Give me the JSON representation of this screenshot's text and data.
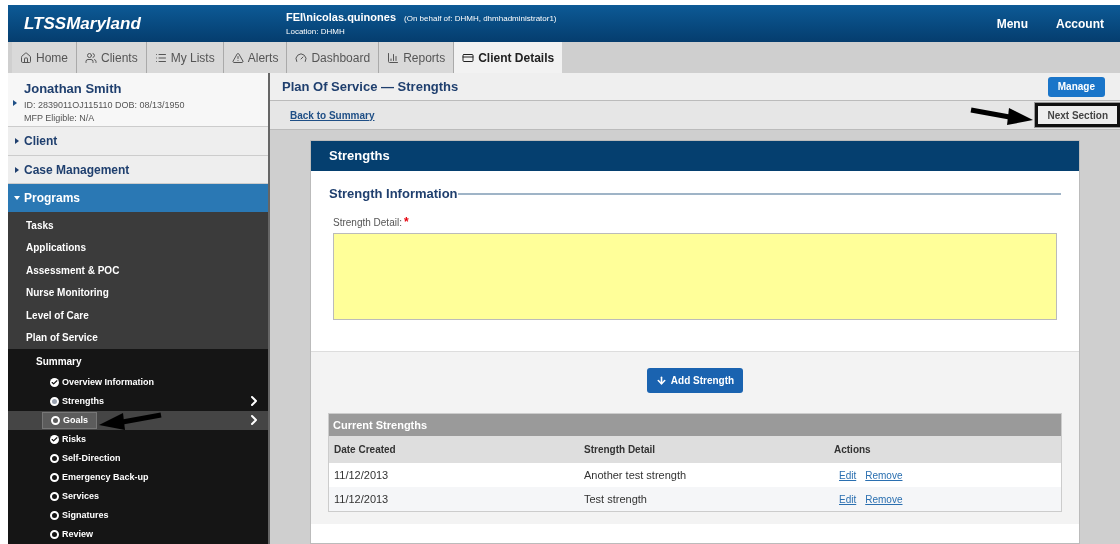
{
  "header": {
    "logo": "LTSSMaryland",
    "user": "FEI\\nicolas.quinones",
    "on_behalf": "(On behalf of: DHMH, dhmhadministrator1)",
    "location": "Location: DHMH",
    "menu": [
      "Menu",
      "Account"
    ]
  },
  "tabs": [
    {
      "label": "Home",
      "selected": false
    },
    {
      "label": "Clients",
      "selected": false
    },
    {
      "label": "My Lists",
      "selected": false
    },
    {
      "label": "Alerts",
      "selected": false
    },
    {
      "label": "Dashboard",
      "selected": false
    },
    {
      "label": "Reports",
      "selected": false
    },
    {
      "label": "Client Details",
      "selected": true
    }
  ],
  "client": {
    "name": "Jonathan Smith",
    "id_line": "ID: 2839011OJ115110 DOB: 08/13/1950",
    "mfp": "MFP Eligible: N/A"
  },
  "sidebar": {
    "sections": [
      {
        "label": "Client",
        "expanded": false
      },
      {
        "label": "Case Management",
        "expanded": false
      },
      {
        "label": "Programs",
        "expanded": true
      }
    ],
    "program_items": [
      "Tasks",
      "Applications",
      "Assessment & POC",
      "Nurse Monitoring",
      "Level of Care",
      "Plan of Service"
    ],
    "summary": "Summary",
    "steps": [
      {
        "label": "Overview Information",
        "kind": "complete",
        "selected": false,
        "chevron": false
      },
      {
        "label": "Strengths",
        "kind": "current",
        "selected": false,
        "chevron": true
      },
      {
        "label": "Goals",
        "kind": "empty",
        "selected": true,
        "chevron": true
      },
      {
        "label": "Risks",
        "kind": "complete",
        "selected": false,
        "chevron": false
      },
      {
        "label": "Self-Direction",
        "kind": "empty",
        "selected": false,
        "chevron": false
      },
      {
        "label": "Emergency Back-up",
        "kind": "empty",
        "selected": false,
        "chevron": false
      },
      {
        "label": "Services",
        "kind": "empty",
        "selected": false,
        "chevron": false
      },
      {
        "label": "Signatures",
        "kind": "empty",
        "selected": false,
        "chevron": false
      },
      {
        "label": "Review",
        "kind": "empty",
        "selected": false,
        "chevron": false
      }
    ]
  },
  "page": {
    "title": "Plan Of Service — Strengths",
    "manage": "Manage",
    "back": "Back to Summary",
    "next": "Next Section"
  },
  "panel": {
    "title": "Strengths",
    "section": "Strength Information",
    "field_label": "Strength Detail:",
    "required": "*",
    "add_button": "Add Strength",
    "table": {
      "title": "Current Strengths",
      "columns": [
        "Date Created",
        "Strength Detail",
        "Actions"
      ],
      "rows": [
        {
          "date": "11/12/2013",
          "detail": "Another test strength",
          "actions": [
            "Edit",
            "Remove"
          ]
        },
        {
          "date": "11/12/2013",
          "detail": "Test strength",
          "actions": [
            "Edit",
            "Remove"
          ]
        }
      ]
    }
  }
}
